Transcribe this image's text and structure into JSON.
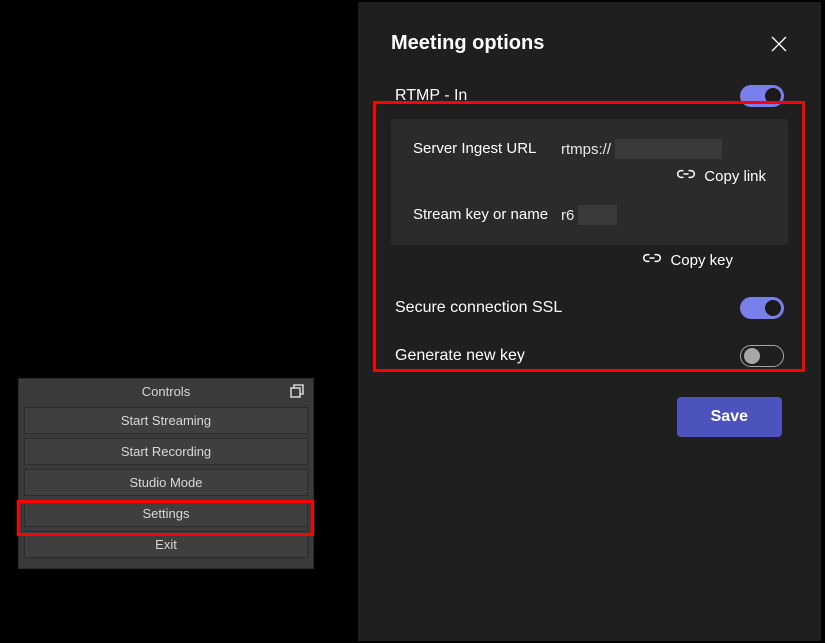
{
  "obs": {
    "header": "Controls",
    "buttons": {
      "start_streaming": "Start Streaming",
      "start_recording": "Start Recording",
      "studio_mode": "Studio Mode",
      "settings": "Settings",
      "exit": "Exit"
    }
  },
  "teams": {
    "title": "Meeting options",
    "rtmp_in": {
      "label": "RTMP - In",
      "enabled": true
    },
    "server_ingest": {
      "label": "Server Ingest URL",
      "value_prefix": "rtmps://"
    },
    "copy_link": "Copy link",
    "stream_key": {
      "label": "Stream key or name",
      "value_prefix": "r6"
    },
    "copy_key": "Copy key",
    "ssl": {
      "label": "Secure connection SSL",
      "enabled": true
    },
    "generate_key": {
      "label": "Generate new key",
      "enabled": false
    },
    "save": "Save"
  }
}
